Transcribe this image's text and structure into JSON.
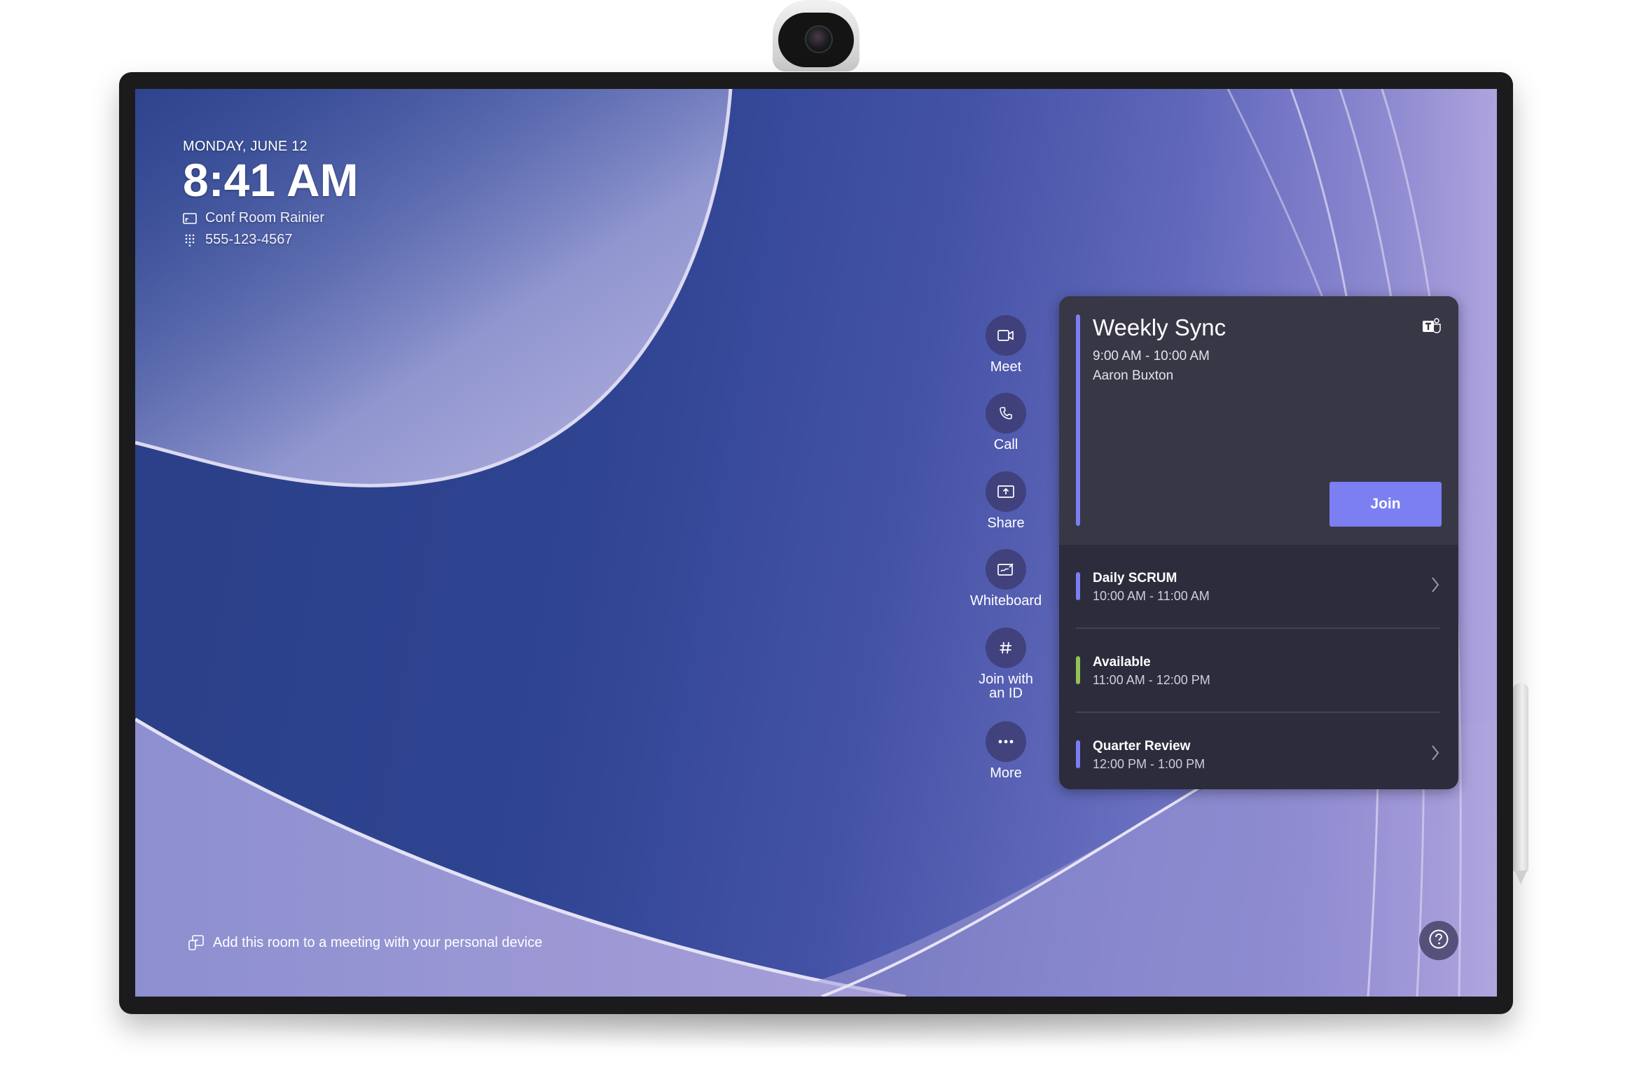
{
  "status": {
    "date": "MONDAY, JUNE 12",
    "time": "8:41 AM",
    "room_name": "Conf Room Rainier",
    "phone_number": "555-123-4567"
  },
  "actions": [
    {
      "id": "meet",
      "label": "Meet",
      "icon": "video-camera-icon"
    },
    {
      "id": "call",
      "label": "Call",
      "icon": "phone-icon"
    },
    {
      "id": "share",
      "label": "Share",
      "icon": "share-screen-icon"
    },
    {
      "id": "whiteboard",
      "label": "Whiteboard",
      "icon": "whiteboard-icon"
    },
    {
      "id": "join-id",
      "label": "Join with an ID",
      "icon": "hash-icon"
    },
    {
      "id": "more",
      "label": "More",
      "icon": "more-icon"
    }
  ],
  "current_meeting": {
    "title": "Weekly Sync",
    "time": "9:00 AM - 10:00 AM",
    "organizer": "Aaron Buxton",
    "join_label": "Join",
    "accent_color": "#7b7ff2",
    "app_icon": "teams-icon"
  },
  "upcoming": [
    {
      "title": "Daily SCRUM",
      "time": "10:00 AM - 11:00 AM",
      "accent_color": "#7b7ff2",
      "has_chevron": true
    },
    {
      "title": "Available",
      "time": "11:00 AM - 12:00 PM",
      "accent_color": "#92c353",
      "has_chevron": false
    },
    {
      "title": "Quarter Review",
      "time": "12:00 PM - 1:00 PM",
      "accent_color": "#7b7ff2",
      "has_chevron": true
    }
  ],
  "footer": {
    "proximity_text": "Add this room to a meeting with your personal device"
  },
  "help": {
    "icon": "help-icon"
  }
}
